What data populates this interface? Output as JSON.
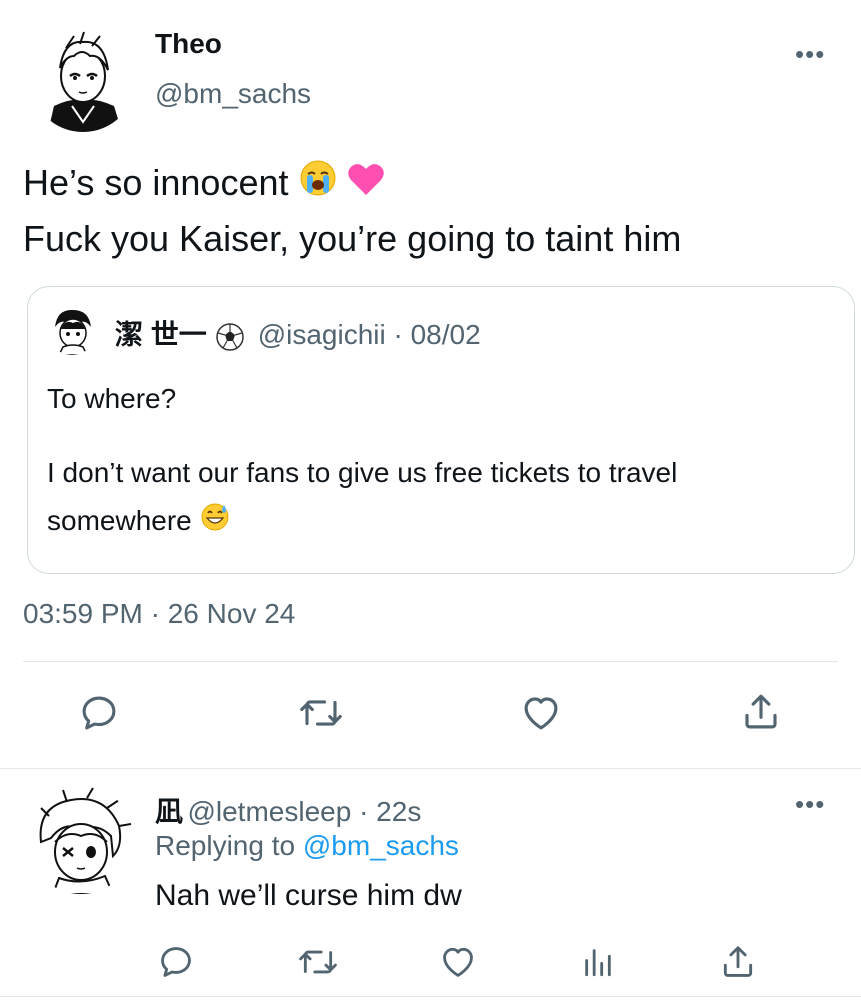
{
  "main_tweet": {
    "display_name": "Theo",
    "handle": "@bm_sachs",
    "text_line1": "He’s so innocent",
    "text_line2": "Fuck you Kaiser, you’re going to taint him",
    "timestamp": "03:59 PM · 26 Nov 24",
    "line1_emojis": [
      "loudly-crying-face",
      "pink-heart"
    ]
  },
  "quoted_tweet": {
    "display_name": "潔 世一",
    "name_emoji": "soccer-ball",
    "handle_date": "@isagichii · 08/02",
    "para1": "To where?",
    "para2": "I don’t want our fans to give us free tickets to travel somewhere",
    "para2_emoji": "grinning-sweat-face"
  },
  "reply": {
    "display_name": "凪",
    "handle_time": "@letmesleep · 22s",
    "replying_prefix": "Replying to",
    "replying_to": "@bm_sachs",
    "text": "Nah we’ll curse him dw"
  },
  "more_glyph": "•••",
  "colors": {
    "text": "#0f1419",
    "secondary": "#536471",
    "link": "#1d9bf0",
    "border": "#cfd9de"
  },
  "icons": [
    "reply-icon",
    "retweet-icon",
    "like-icon",
    "share-icon",
    "views-icon"
  ]
}
